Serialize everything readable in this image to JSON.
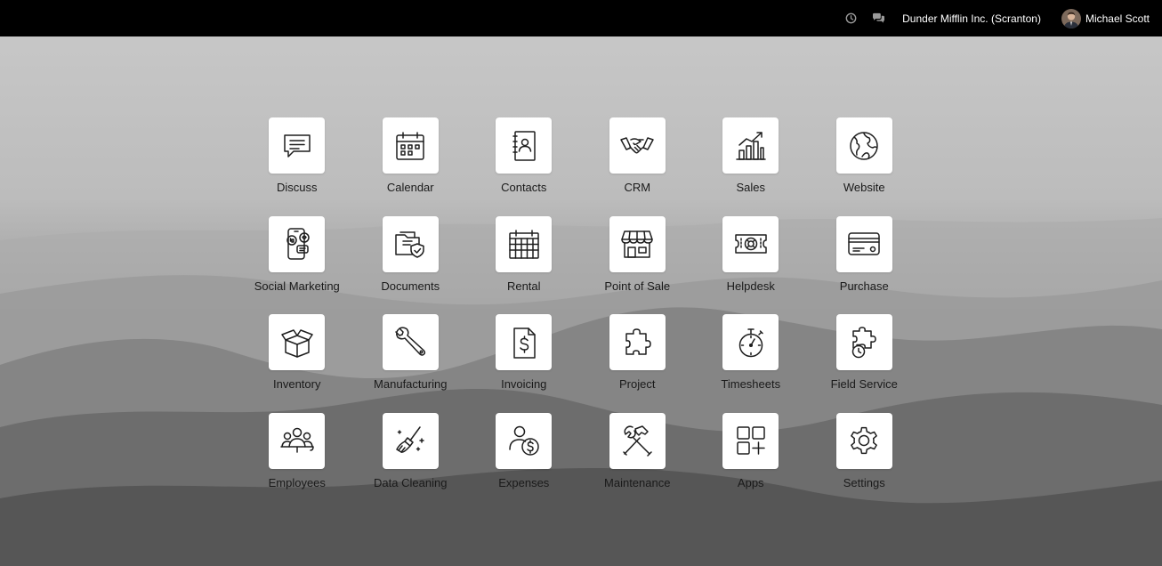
{
  "topbar": {
    "company": "Dunder Mifflin Inc. (Scranton)",
    "user_name": "Michael Scott",
    "activity_icon": "clock-icon",
    "messages_icon": "chat-bubbles-icon"
  },
  "colors": {
    "topbar_bg": "#000000",
    "tile_bg": "#ffffff",
    "label_text": "#1a1a1a"
  },
  "apps": [
    {
      "label": "Discuss",
      "icon": "chat-bubble-icon"
    },
    {
      "label": "Calendar",
      "icon": "calendar-icon"
    },
    {
      "label": "Contacts",
      "icon": "address-book-icon"
    },
    {
      "label": "CRM",
      "icon": "handshake-icon"
    },
    {
      "label": "Sales",
      "icon": "bar-chart-icon"
    },
    {
      "label": "Website",
      "icon": "globe-icon"
    },
    {
      "label": "Social Marketing",
      "icon": "smartphone-social-icon"
    },
    {
      "label": "Documents",
      "icon": "folder-shield-icon"
    },
    {
      "label": "Rental",
      "icon": "calendar-grid-icon"
    },
    {
      "label": "Point of Sale",
      "icon": "storefront-icon"
    },
    {
      "label": "Helpdesk",
      "icon": "lifebuoy-ticket-icon"
    },
    {
      "label": "Purchase",
      "icon": "credit-card-icon"
    },
    {
      "label": "Inventory",
      "icon": "open-box-icon"
    },
    {
      "label": "Manufacturing",
      "icon": "wrench-icon"
    },
    {
      "label": "Invoicing",
      "icon": "dollar-document-icon"
    },
    {
      "label": "Project",
      "icon": "puzzle-piece-icon"
    },
    {
      "label": "Timesheets",
      "icon": "stopwatch-icon"
    },
    {
      "label": "Field Service",
      "icon": "puzzle-clock-icon"
    },
    {
      "label": "Employees",
      "icon": "people-group-icon"
    },
    {
      "label": "Data Cleaning",
      "icon": "broom-sparkle-icon"
    },
    {
      "label": "Expenses",
      "icon": "person-coin-icon"
    },
    {
      "label": "Maintenance",
      "icon": "hammer-wrench-icon"
    },
    {
      "label": "Apps",
      "icon": "app-grid-plus-icon"
    },
    {
      "label": "Settings",
      "icon": "gear-icon"
    }
  ]
}
